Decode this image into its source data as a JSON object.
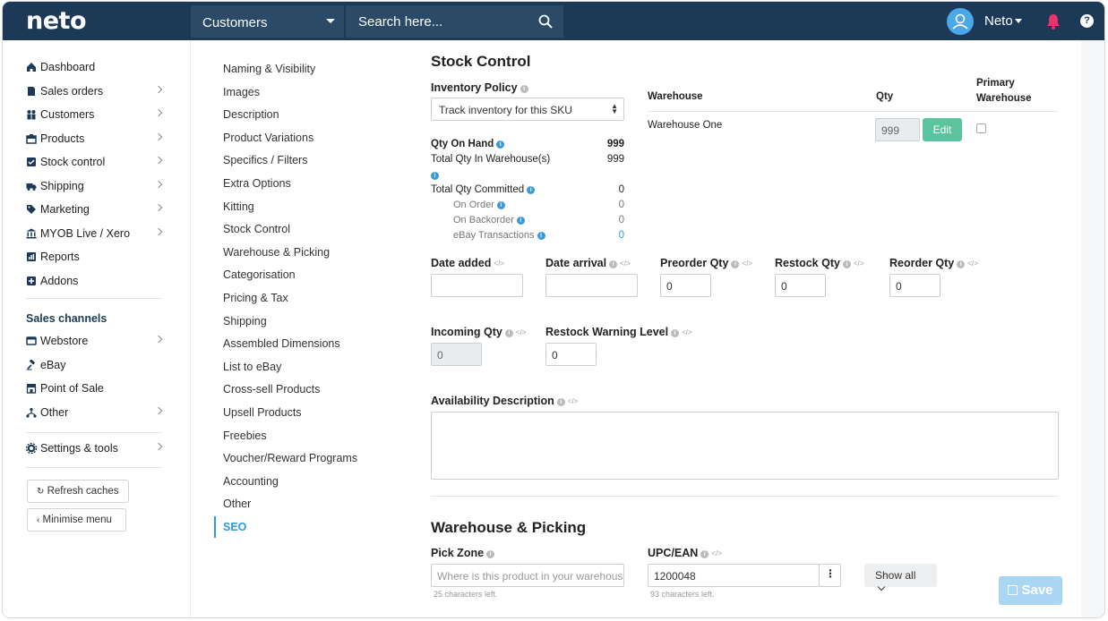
{
  "topbar": {
    "logo": "neto",
    "module": "Customers",
    "search_placeholder": "Search here...",
    "user_name": "Neto",
    "help": "?"
  },
  "sidebar": {
    "items": [
      {
        "label": "Dashboard",
        "icon": "home-icon",
        "chevron": false
      },
      {
        "label": "Sales orders",
        "icon": "document-icon",
        "chevron": true
      },
      {
        "label": "Customers",
        "icon": "users-icon",
        "chevron": true
      },
      {
        "label": "Products",
        "icon": "box-icon",
        "chevron": true
      },
      {
        "label": "Stock control",
        "icon": "check-square-icon",
        "chevron": true
      },
      {
        "label": "Shipping",
        "icon": "truck-icon",
        "chevron": true
      },
      {
        "label": "Marketing",
        "icon": "tag-icon",
        "chevron": true
      },
      {
        "label": "MYOB Live / Xero",
        "icon": "bank-icon",
        "chevron": true
      },
      {
        "label": "Reports",
        "icon": "report-icon",
        "chevron": false
      },
      {
        "label": "Addons",
        "icon": "plus-square-icon",
        "chevron": false
      }
    ],
    "channels_title": "Sales channels",
    "channels": [
      {
        "label": "Webstore",
        "icon": "window-icon",
        "chevron": true
      },
      {
        "label": "eBay",
        "icon": "gavel-icon",
        "chevron": false
      },
      {
        "label": "Point of Sale",
        "icon": "store-icon",
        "chevron": false
      },
      {
        "label": "Other",
        "icon": "sitemap-icon",
        "chevron": true
      }
    ],
    "settings": {
      "label": "Settings & tools",
      "icon": "gear-icon"
    },
    "refresh_label": "Refresh caches",
    "minimise_label": "Minimise menu"
  },
  "section_nav": {
    "items": [
      "Naming & Visibility",
      "Images",
      "Description",
      "Product Variations",
      "Specifics / Filters",
      "Extra Options",
      "Kitting",
      "Stock Control",
      "Warehouse & Picking",
      "Categorisation",
      "Pricing & Tax",
      "Shipping",
      "Assembled Dimensions",
      "List to eBay",
      "Cross-sell Products",
      "Upsell Products",
      "Freebies",
      "Voucher/Reward Programs",
      "Accounting",
      "Other",
      "SEO"
    ],
    "active": "SEO"
  },
  "stock_control": {
    "title": "Stock Control",
    "inventory_policy_label": "Inventory Policy",
    "inventory_policy_value": "Track inventory for this SKU",
    "qty_on_hand_label": "Qty On Hand",
    "qty_on_hand": "999",
    "total_in_wh_label": "Total Qty In Warehouse(s)",
    "total_in_wh": "999",
    "total_committed_label": "Total Qty Committed",
    "total_committed": "0",
    "on_order_label": "On Order",
    "on_order": "0",
    "on_backorder_label": "On Backorder",
    "on_backorder": "0",
    "ebay_tx_label": "eBay Transactions",
    "ebay_tx": "0",
    "wh_table": {
      "col_warehouse": "Warehouse",
      "col_qty": "Qty",
      "col_primary_1": "Primary",
      "col_primary_2": "Warehouse",
      "row_name": "Warehouse One",
      "row_qty": "999",
      "edit_label": "Edit"
    },
    "date_added_label": "Date added",
    "date_arrival_label": "Date arrival",
    "preorder_label": "Preorder Qty",
    "preorder_value": "0",
    "restock_label": "Restock Qty",
    "restock_value": "0",
    "reorder_label": "Reorder Qty",
    "reorder_value": "0",
    "incoming_label": "Incoming Qty",
    "incoming_value": "0",
    "restock_warning_label": "Restock Warning Level",
    "restock_warning_value": "0",
    "availability_label": "Availability Description"
  },
  "warehouse_picking": {
    "title": "Warehouse & Picking",
    "pick_zone_label": "Pick Zone",
    "pick_zone_placeholder": "Where is this product in your warehouse?",
    "pick_zone_hint": "25 characters left.",
    "upc_label": "UPC/EAN",
    "upc_value": "1200048",
    "upc_hint": "93 characters left.",
    "show_all_label": "Show all",
    "save_label": "Save"
  },
  "colors": {
    "topbar": "#1c3a57",
    "accent": "#2e9bd6",
    "edit_button": "#5bc49e",
    "save_button": "#a9d6f3",
    "bell": "#e8336d"
  }
}
